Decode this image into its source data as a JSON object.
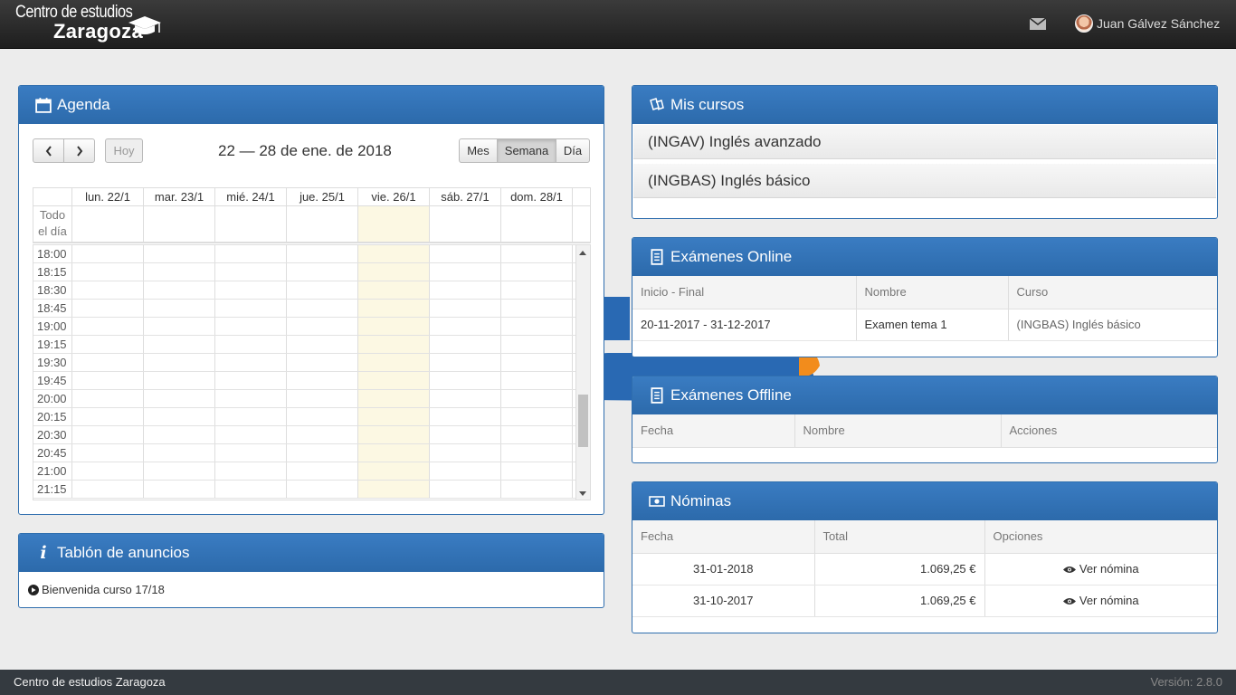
{
  "brand": {
    "line1": "Centro de estudios",
    "line2": "Zaragoza"
  },
  "navbar": {
    "user_name": "Juan Gálvez Sánchez",
    "icons": [
      "mail-icon",
      "avatar"
    ]
  },
  "agenda": {
    "title": "Agenda",
    "today_label": "Hoy",
    "range_title": "22 — 28 de ene. de 2018",
    "views": [
      "Mes",
      "Semana",
      "Día"
    ],
    "active_view": "Semana",
    "days": [
      "lun. 22/1",
      "mar. 23/1",
      "mié. 24/1",
      "jue. 25/1",
      "vie. 26/1",
      "sáb. 27/1",
      "dom. 28/1"
    ],
    "today_day": "vie. 26/1",
    "allday_label_1": "Todo",
    "allday_label_2": "el día",
    "times": [
      "18:00",
      "18:15",
      "18:30",
      "18:45",
      "19:00",
      "19:15",
      "19:30",
      "19:45",
      "20:00",
      "20:15",
      "20:30",
      "20:45",
      "21:00",
      "21:15"
    ]
  },
  "tablon": {
    "title": "Tablón de anuncios",
    "items": [
      "Bienvenida curso 17/18"
    ]
  },
  "cursos": {
    "title": "Mis cursos",
    "items": [
      "(INGAV) Inglés avanzado",
      "(INGBAS) Inglés básico"
    ]
  },
  "online": {
    "title": "Exámenes Online",
    "columns": [
      "Inicio - Final",
      "Nombre",
      "Curso"
    ],
    "rows": [
      [
        "20-11-2017 - 31-12-2017",
        "Examen tema 1",
        "(INGBAS) Inglés básico"
      ]
    ]
  },
  "offline": {
    "title": "Exámenes Offline",
    "columns": [
      "Fecha",
      "Nombre",
      "Acciones"
    ]
  },
  "nominas": {
    "title": "Nóminas",
    "columns": [
      "Fecha",
      "Total",
      "Opciones"
    ],
    "rows": [
      {
        "fecha": "31-01-2018",
        "total": "1.069,25 €",
        "accion": "Ver nómina"
      },
      {
        "fecha": "31-10-2017",
        "total": "1.069,25 €",
        "accion": "Ver nómina"
      }
    ]
  },
  "footer": {
    "left": "Centro de estudios Zaragoza",
    "version": "Versión: 2.8.0"
  },
  "colors": {
    "panel_header": "#2f6fb0",
    "navbar": "#2a2a2a",
    "today_column": "#fcf8e3",
    "footer": "#343a40"
  }
}
